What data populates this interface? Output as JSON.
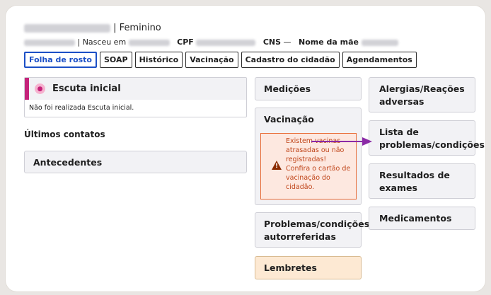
{
  "patient": {
    "gender_separator": "|",
    "gender": "Feminino",
    "born_label": "| Nasceu em",
    "cpf_label": "CPF",
    "cns_label": "CNS",
    "cns_value": "—",
    "mother_label": "Nome da mãe"
  },
  "tabs": [
    "Folha de rosto",
    "SOAP",
    "Histórico",
    "Vacinação",
    "Cadastro do cidadão",
    "Agendamentos"
  ],
  "escuta": {
    "title": "Escuta inicial",
    "message": "Não foi realizada Escuta inicial."
  },
  "ultimos_contatos": "Últimos contatos",
  "antecedentes": "Antecedentes",
  "medicoes": "Medições",
  "vacinacao": {
    "title": "Vacinação",
    "warning_lines": [
      "Existem vacinas",
      "atrasadas ou não",
      "registradas!",
      "Confira o cartão de",
      "vacinação do",
      "cidadão."
    ]
  },
  "problemas_autorreferidas": [
    "Problemas/condições",
    "autorreferidas"
  ],
  "lembretes": "Lembretes",
  "right_tiles": {
    "alergias": [
      "Alergias/Reações",
      "adversas"
    ],
    "lista": [
      "Lista de",
      "problemas/condições"
    ],
    "resultados": [
      "Resultados de",
      "exames"
    ],
    "medicamentos": "Medicamentos"
  },
  "colors": {
    "active_tab": "#1b4fc6",
    "escuta_accent": "#c5237a",
    "warning_border": "#e86a35",
    "warning_bg": "#fde8e0",
    "lembretes_bg": "#fde9d3",
    "arrow": "#8a2aa6"
  }
}
